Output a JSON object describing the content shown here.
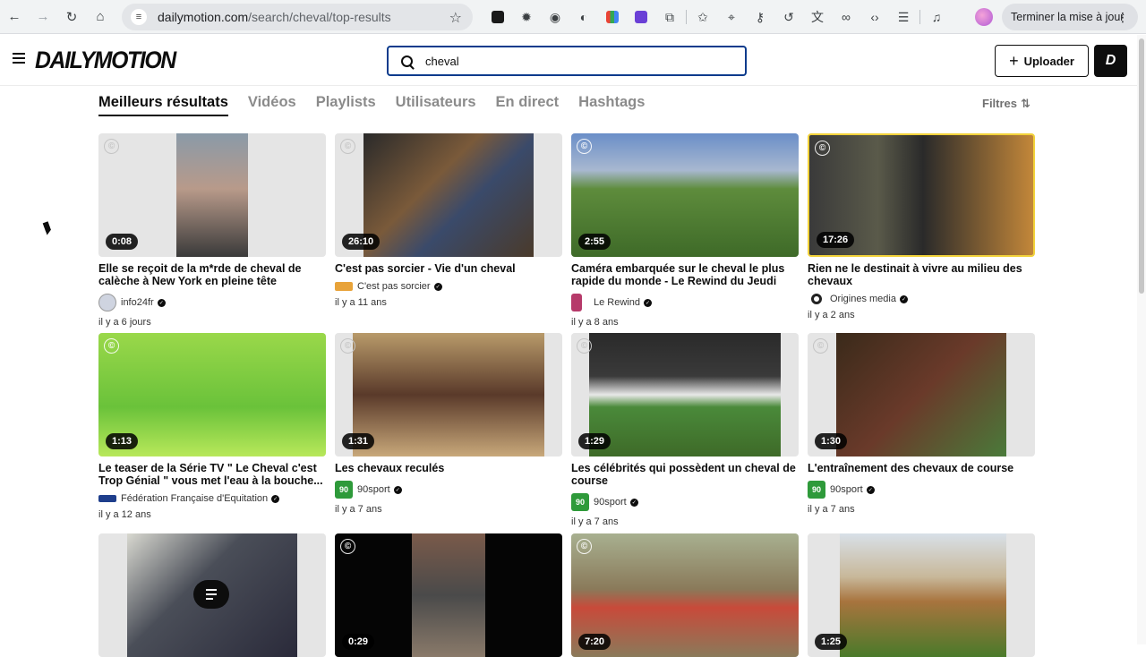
{
  "browser": {
    "url_domain": "dailymotion.com",
    "url_path": "/search/cheval/top-results",
    "update_button": "Terminer la mise à jour"
  },
  "header": {
    "logo": "DAILYMOTION",
    "search_value": "cheval",
    "upload_label": "Uploader"
  },
  "tabs": [
    "Meilleurs résultats",
    "Vidéos",
    "Playlists",
    "Utilisateurs",
    "En direct",
    "Hashtags"
  ],
  "filters_label": "Filtres",
  "videos": [
    {
      "title": "Elle se reçoit de la m*rde de cheval de calèche à New York en pleine tête",
      "duration": "0:08",
      "channel": "info24fr",
      "date": "il y a 6 jours",
      "avatar_color": "#cfd4e0",
      "thumb": "#8f8a86",
      "bg": "#e5e5e5"
    },
    {
      "title": "C'est pas sorcier - Vie d'un cheval",
      "duration": "26:10",
      "channel": "C'est pas sorcier",
      "date": "il y a 11 ans",
      "avatar_color": "#e8a33a",
      "thumb": "#6a5440",
      "bg": "#e5e5e5"
    },
    {
      "title": "Caméra embarquée sur le cheval le plus rapide du monde - Le Rewind du Jeudi 22...",
      "duration": "2:55",
      "channel": "Le Rewind",
      "date": "il y a 8 ans",
      "avatar_color": "#b63a6a",
      "thumb": "#5e8c3c",
      "bg": "#5e8c3c"
    },
    {
      "title": "Rien ne le destinait à vivre au milieu des chevaux",
      "duration": "17:26",
      "channel": "Origines media",
      "date": "il y a 2 ans",
      "avatar_color": "#222222",
      "thumb": "#3a3a3a",
      "bg": "#3a3a3a"
    },
    {
      "title": "Le teaser de la Série TV \" Le Cheval c'est Trop Génial \" vous met l'eau à la bouche...",
      "duration": "1:13",
      "channel": "Fédération Française d'Equitation",
      "date": "il y a 12 ans",
      "avatar_color": "#1e3e8c",
      "thumb": "#7fd23c",
      "bg": "#7fd23c"
    },
    {
      "title": "Les chevaux reculés",
      "duration": "1:31",
      "channel": "90sport",
      "date": "il y a 7 ans",
      "avatar_color": "#2e9a3a",
      "thumb": "#8a6a44",
      "bg": "#e5e5e5"
    },
    {
      "title": "Les célébrités qui possèdent un cheval de course",
      "duration": "1:29",
      "channel": "90sport",
      "date": "il y a 7 ans",
      "avatar_color": "#2e9a3a",
      "thumb": "#4a6a3a",
      "bg": "#e5e5e5"
    },
    {
      "title": "L'entraînement des chevaux de course",
      "duration": "1:30",
      "channel": "90sport",
      "date": "il y a 7 ans",
      "avatar_color": "#2e9a3a",
      "thumb": "#5a3a2a",
      "bg": "#e5e5e5"
    },
    {
      "title": "",
      "duration": "",
      "channel": "",
      "date": "",
      "avatar_color": "",
      "thumb": "#4a4e58",
      "bg": "#e5e5e5"
    },
    {
      "title": "",
      "duration": "0:29",
      "channel": "",
      "date": "",
      "avatar_color": "",
      "thumb": "#3a3a3a",
      "bg": "#050505"
    },
    {
      "title": "",
      "duration": "7:20",
      "channel": "",
      "date": "",
      "avatar_color": "",
      "thumb": "#8a7a5a",
      "bg": "#8a7a5a"
    },
    {
      "title": "",
      "duration": "1:25",
      "channel": "",
      "date": "",
      "avatar_color": "",
      "thumb": "#a8743e",
      "bg": "#e5e5e5"
    }
  ]
}
